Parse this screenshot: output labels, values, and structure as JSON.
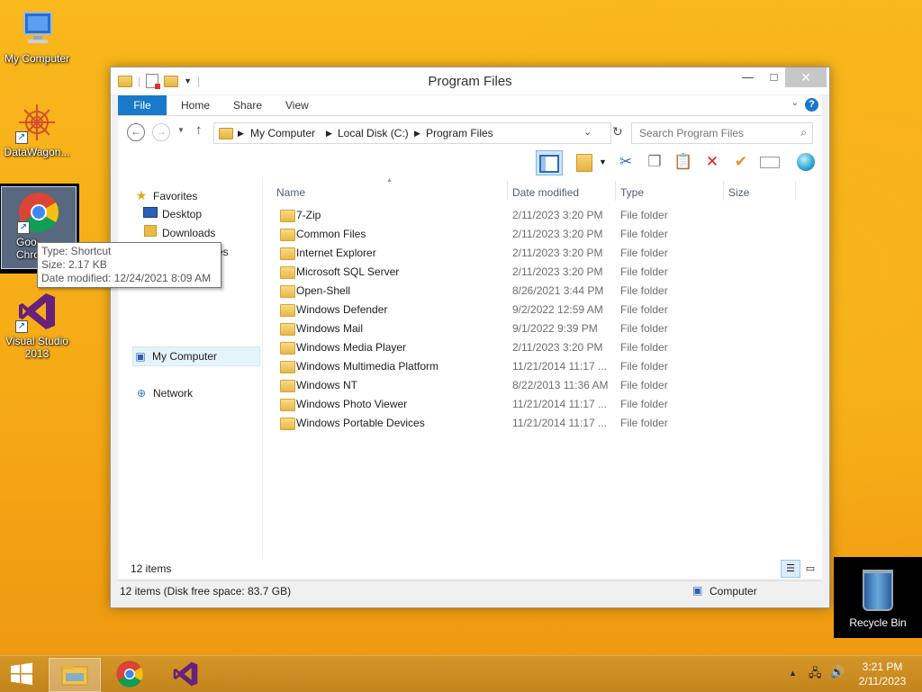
{
  "desktop": {
    "icons": {
      "my_computer": "My Computer",
      "datawagon": "DataWagon...",
      "chrome_partial": "Goo Chro",
      "visual_studio": "Visual Studio 2013"
    },
    "recycle_bin": "Recycle Bin"
  },
  "tooltip": {
    "type": "Type: Shortcut",
    "size": "Size: 2.17 KB",
    "modified": "Date modified: 12/24/2021 8:09 AM"
  },
  "window": {
    "title": "Program Files",
    "ribbon_tabs": [
      "File",
      "Home",
      "Share",
      "View"
    ],
    "address": {
      "crumbs": [
        "My Computer",
        "Local Disk (C:)",
        "Program Files"
      ]
    },
    "search": {
      "placeholder": "Search Program Files"
    },
    "nav": {
      "favorites": "Favorites",
      "desktop": "Desktop",
      "downloads": "Downloads",
      "recent_partial": "ces",
      "my_computer": "My Computer",
      "network": "Network"
    },
    "columns": {
      "name": "Name",
      "date": "Date modified",
      "type": "Type",
      "size": "Size"
    },
    "files": [
      {
        "name": "7-Zip",
        "date": "2/11/2023 3:20 PM",
        "type": "File folder"
      },
      {
        "name": "Common Files",
        "date": "2/11/2023 3:20 PM",
        "type": "File folder"
      },
      {
        "name": "Internet Explorer",
        "date": "2/11/2023 3:20 PM",
        "type": "File folder"
      },
      {
        "name": "Microsoft SQL Server",
        "date": "2/11/2023 3:20 PM",
        "type": "File folder"
      },
      {
        "name": "Open-Shell",
        "date": "8/26/2021 3:44 PM",
        "type": "File folder"
      },
      {
        "name": "Windows Defender",
        "date": "9/2/2022 12:59 AM",
        "type": "File folder"
      },
      {
        "name": "Windows Mail",
        "date": "9/1/2022 9:39 PM",
        "type": "File folder"
      },
      {
        "name": "Windows Media Player",
        "date": "2/11/2023 3:20 PM",
        "type": "File folder"
      },
      {
        "name": "Windows Multimedia Platform",
        "date": "11/21/2014 11:17 ...",
        "type": "File folder"
      },
      {
        "name": "Windows NT",
        "date": "8/22/2013 11:36 AM",
        "type": "File folder"
      },
      {
        "name": "Windows Photo Viewer",
        "date": "11/21/2014 11:17 ...",
        "type": "File folder"
      },
      {
        "name": "Windows Portable Devices",
        "date": "11/21/2014 11:17 ...",
        "type": "File folder"
      }
    ],
    "item_count": "12 items",
    "status_bar": "12 items (Disk free space: 83.7 GB)",
    "status_location": "Computer"
  },
  "taskbar": {
    "time": "3:21 PM",
    "date": "2/11/2023"
  }
}
